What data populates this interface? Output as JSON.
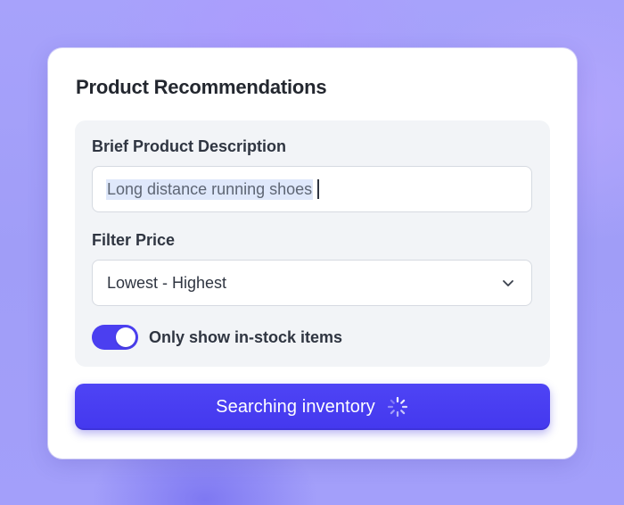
{
  "card": {
    "title": "Product Recommendations"
  },
  "form": {
    "description_label": "Brief Product Description",
    "description_value": "Long distance running shoes",
    "price_label": "Filter Price",
    "price_selected": "Lowest - Highest",
    "in_stock_toggle": {
      "label": "Only show in-stock items",
      "on": true
    }
  },
  "action_button": {
    "label": "Searching inventory",
    "state": "loading"
  },
  "icons": {
    "select": "chevron-down-icon",
    "button": "loading-spinner-icon"
  },
  "colors": {
    "accent": "#4b3ff0",
    "background": "#a29ff8",
    "panel": "#f2f4f7",
    "text": "#2f3541"
  }
}
